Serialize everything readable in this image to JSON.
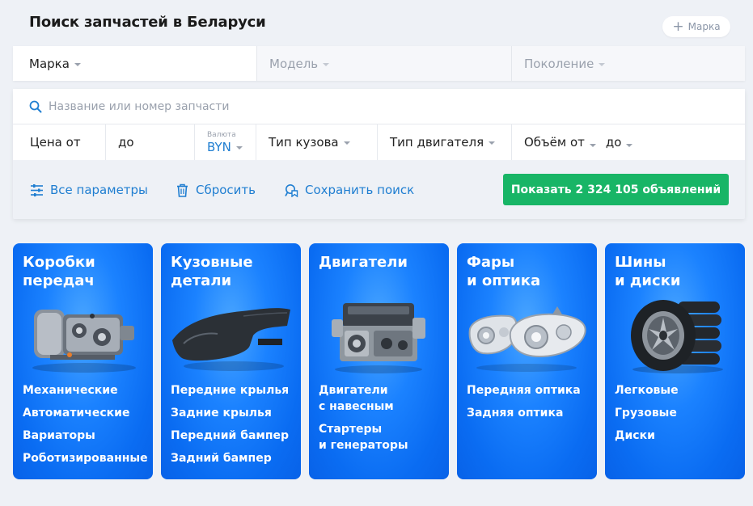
{
  "header": {
    "title": "Поиск запчастей в Беларуси",
    "add_brand": "Марка"
  },
  "selectors": {
    "brand": "Марка",
    "model": "Модель",
    "generation": "Поколение"
  },
  "search": {
    "placeholder": "Название или номер запчасти"
  },
  "filters": {
    "price_from": "Цена от",
    "price_to": "до",
    "currency_label": "Валюта",
    "currency_value": "BYN",
    "body_type": "Тип кузова",
    "engine_type": "Тип двигателя",
    "volume_from": "Объём от",
    "volume_to": "до"
  },
  "actions": {
    "all_params": "Все параметры",
    "reset": "Сбросить",
    "save_search": "Сохранить поиск",
    "show": "Показать 2 324 105 объявлений"
  },
  "colors": {
    "accent": "#1f7ed1",
    "cta": "#18b566",
    "card": "#0a6cf2"
  },
  "categories": [
    {
      "title": "Коробки\nпередач",
      "icon": "gearbox-icon",
      "links": [
        "Механические",
        "Автоматические",
        "Вариаторы",
        "Роботизированные"
      ]
    },
    {
      "title": "Кузовные\nдетали",
      "icon": "car-fender-icon",
      "links": [
        "Передние крылья",
        "Задние крылья",
        "Передний бампер",
        "Задний бампер"
      ]
    },
    {
      "title": "Двигатели",
      "icon": "engine-icon",
      "links": [
        "Двигатели\nс навесным",
        "Стартеры\nи генераторы"
      ]
    },
    {
      "title": "Фары\nи оптика",
      "icon": "headlights-icon",
      "links": [
        "Передняя оптика",
        "Задняя оптика"
      ]
    },
    {
      "title": "Шины\nи диски",
      "icon": "tires-icon",
      "links": [
        "Легковые",
        "Грузовые",
        "Диски"
      ]
    }
  ]
}
